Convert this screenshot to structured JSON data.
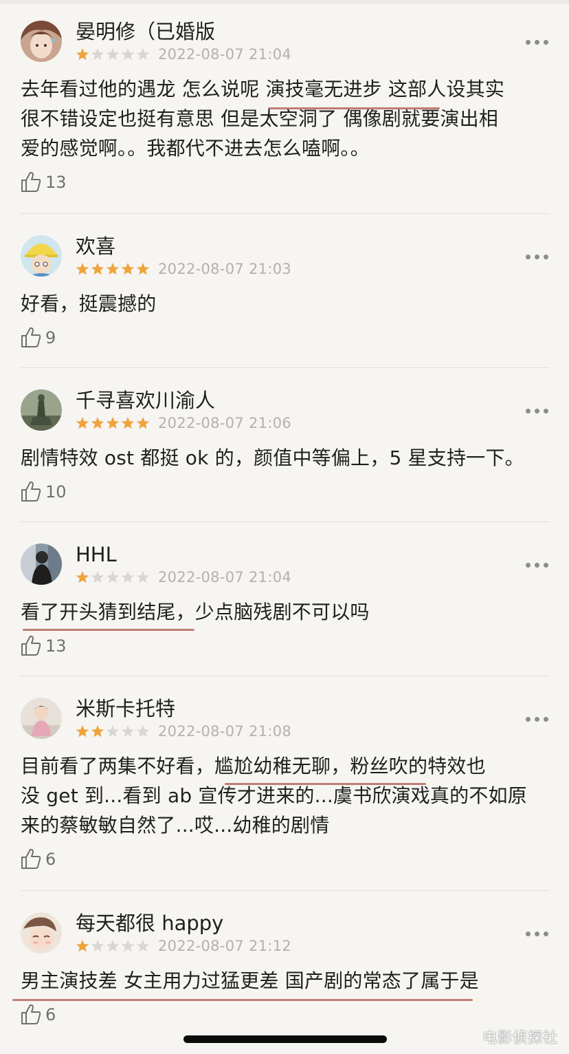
{
  "comments": [
    {
      "username": "晏明修（已婚版",
      "stars": 1,
      "date": "2022-08-07 21:04",
      "lines": [
        "去年看过他的遇龙 怎么说呢 演技毫无进步 这部人设其实",
        "很不错设定也挺有意思 但是太空洞了 偶像剧就要演出相",
        "爱的感觉啊。。我都代不进去怎么嗑啊。。"
      ],
      "likes": "13"
    },
    {
      "username": "欢喜",
      "stars": 5,
      "date": "2022-08-07 21:03",
      "lines": [
        "好看，挺震撼的"
      ],
      "likes": "9"
    },
    {
      "username": "千寻喜欢川渝人",
      "stars": 5,
      "date": "2022-08-07 21:06",
      "lines": [
        "剧情特效 ost 都挺 ok 的，颜值中等偏上，5 星支持一下。"
      ],
      "likes": "10"
    },
    {
      "username": "HHL",
      "stars": 1,
      "date": "2022-08-07 21:04",
      "lines": [
        "看了开头猜到结尾，少点脑残剧不可以吗"
      ],
      "likes": "13"
    },
    {
      "username": "米斯卡托特",
      "stars": 2,
      "date": "2022-08-07 21:08",
      "lines": [
        "目前看了两集不好看，尴尬幼稚无聊，粉丝吹的特效也",
        "没 get 到...看到 ab 宣传才进来的...虞书欣演戏真的不如原",
        "来的蔡敏敏自然了...哎...幼稚的剧情"
      ],
      "likes": "6"
    },
    {
      "username": "每天都很 happy",
      "stars": 1,
      "date": "2022-08-07 21:12",
      "lines": [
        "男主演技差 女主用力过猛更差 国产剧的常态了属于是"
      ],
      "likes": "6"
    }
  ],
  "watermark": "电影侦探社",
  "colors": {
    "background": "#f6f5f2",
    "star_filled": "#f0a33c",
    "star_empty": "#d9d7d3",
    "underline": "#b36a5e"
  },
  "icons": {
    "like": "thumbs-up-icon",
    "more": "more-dots-icon"
  }
}
